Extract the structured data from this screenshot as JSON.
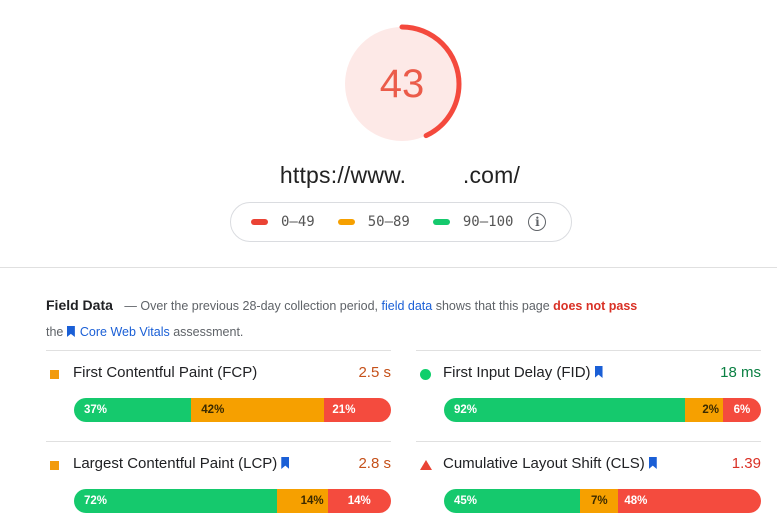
{
  "score": {
    "value": "43",
    "fraction": 0.43,
    "color": "#eb5b4a",
    "track": "#fde9e7"
  },
  "url": {
    "prefix": "https://www.",
    "suffix": ".com/"
  },
  "legend": [
    {
      "label": "0–49",
      "color": "#ea4335"
    },
    {
      "label": "50–89",
      "color": "#f6a000"
    },
    {
      "label": "90–100",
      "color": "#15c96d"
    }
  ],
  "legend_info_icon": "info-icon",
  "field_data": {
    "title": "Field Data",
    "dash": "—",
    "text1": "Over the previous 28-day collection period,",
    "link1": "field data",
    "text2": "shows that this page",
    "fail": "does not pass",
    "text3": "the",
    "link2": "Core Web Vitals",
    "text4": "assessment."
  },
  "metrics": [
    {
      "name": "First Contentful Paint (FCP)",
      "value": "2.5 s",
      "value_color": "#c5511a",
      "icon": "square-icon",
      "good": "37%",
      "ni": "42%",
      "poor": "21%"
    },
    {
      "name": "First Input Delay (FID)",
      "value": "18 ms",
      "value_color": "#0b8043",
      "icon": "circle-icon",
      "good": "92%",
      "ni": "2%",
      "poor": "6%"
    },
    {
      "name": "Largest Contentful Paint (LCP)",
      "value": "2.8 s",
      "value_color": "#c5511a",
      "icon": "square-icon",
      "good": "72%",
      "ni": "14%",
      "poor": "14%"
    },
    {
      "name": "Cumulative Layout Shift (CLS)",
      "value": "1.39",
      "value_color": "#d93025",
      "icon": "triangle-icon",
      "good": "45%",
      "ni": "7%",
      "poor": "48%"
    }
  ]
}
